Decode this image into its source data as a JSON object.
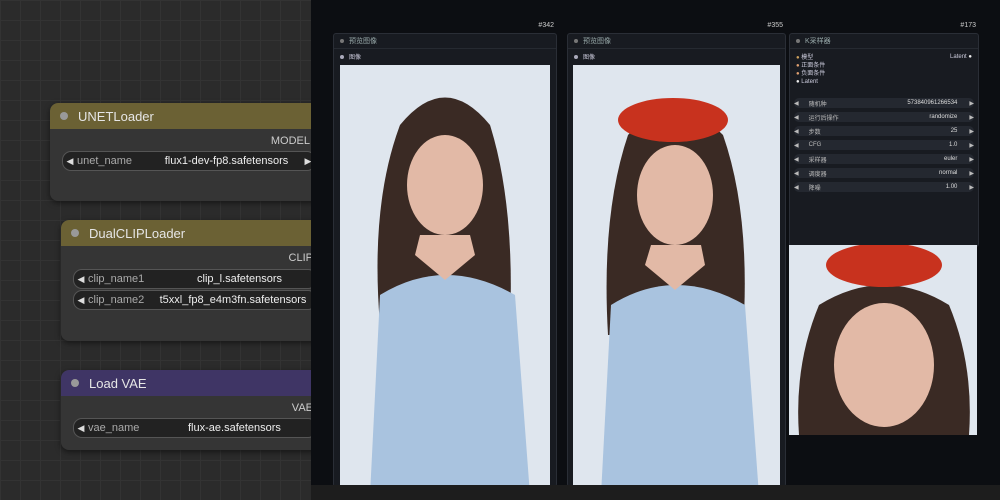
{
  "nodes": {
    "unet": {
      "title": "UNETLoader",
      "output": "MODEL",
      "widget_name": "unet_name",
      "widget_value": "flux1-dev-fp8.safetensors",
      "header_color": "#6b6134"
    },
    "clip": {
      "title": "DualCLIPLoader",
      "output": "CLIP",
      "w1_name": "clip_name1",
      "w1_value": "clip_l.safetensors",
      "w2_name": "clip_name2",
      "w2_value": "t5xxl_fp8_e4m3fn.safetensors",
      "header_color": "#6b6134"
    },
    "vae": {
      "title": "Load VAE",
      "output": "VAE",
      "widget_name": "vae_name",
      "widget_value": "flux-ae.safetensors",
      "header_color": "#3f3565"
    }
  },
  "panels": {
    "p1": {
      "id": "#342",
      "title": "预览图像",
      "output": "图像"
    },
    "p2": {
      "id": "#355",
      "title": "预览图像",
      "output": "图像"
    },
    "p3": {
      "id": "#173",
      "title": "K采样器",
      "inputs": [
        "模型",
        "正面条件",
        "负面条件",
        "Latent"
      ],
      "output": "Latent",
      "rows": [
        {
          "label": "随机种",
          "value": "573840961266534"
        },
        {
          "label": "运行后操作",
          "value": "randomize"
        },
        {
          "label": "步数",
          "value": "25"
        },
        {
          "label": "CFG",
          "value": "1.0"
        },
        {
          "label": "采样器",
          "value": "euler"
        },
        {
          "label": "调度器",
          "value": "normal"
        },
        {
          "label": "降噪",
          "value": "1.00"
        }
      ]
    }
  },
  "colors": {
    "unet_header": "#6b6134",
    "vae_header": "#3f3565",
    "canvas": "#2b2b2b"
  }
}
